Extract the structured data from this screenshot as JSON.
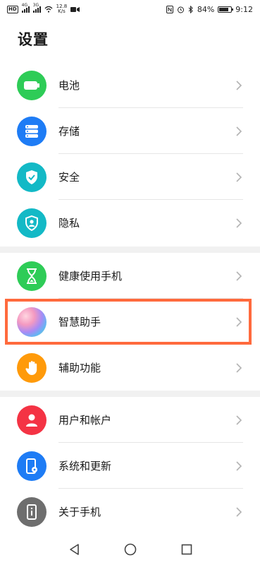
{
  "status_bar": {
    "hd": "HD",
    "sim1_tag": "4G",
    "sim2_tag": "3G",
    "net_speed_value": "12.8",
    "net_speed_unit": "K/s",
    "battery_percent": "84%",
    "battery_level": 0.84,
    "time": "9:12",
    "icons": [
      "video-icon",
      "nfc-icon",
      "alarm-icon",
      "bluetooth-icon"
    ]
  },
  "page": {
    "title": "设置"
  },
  "sections": [
    {
      "items": [
        {
          "label": "电池",
          "icon": "battery-icon",
          "color": "#2ecc57"
        },
        {
          "label": "存储",
          "icon": "storage-icon",
          "color": "#1e7cf5"
        },
        {
          "label": "安全",
          "icon": "shield-check-icon",
          "color": "#13b9c6"
        },
        {
          "label": "隐私",
          "icon": "privacy-shield-icon",
          "color": "#13b9c6"
        }
      ]
    },
    {
      "items": [
        {
          "label": "健康使用手机",
          "icon": "hourglass-icon",
          "color": "#2ecc57"
        },
        {
          "label": "智慧助手",
          "icon": "assistant-orb-icon",
          "color": "#f5a3b8"
        },
        {
          "label": "辅助功能",
          "icon": "hand-icon",
          "color": "#ff9a0a"
        }
      ]
    },
    {
      "items": [
        {
          "label": "用户和帐户",
          "icon": "user-icon",
          "color": "#f43344"
        },
        {
          "label": "系统和更新",
          "icon": "system-update-icon",
          "color": "#1e7cf5"
        },
        {
          "label": "关于手机",
          "icon": "phone-info-icon",
          "color": "#6e6e6e"
        }
      ]
    }
  ],
  "highlight_color": "#ff6a3d",
  "nav": {
    "back": "back-icon",
    "home": "home-icon",
    "recents": "recents-icon"
  }
}
